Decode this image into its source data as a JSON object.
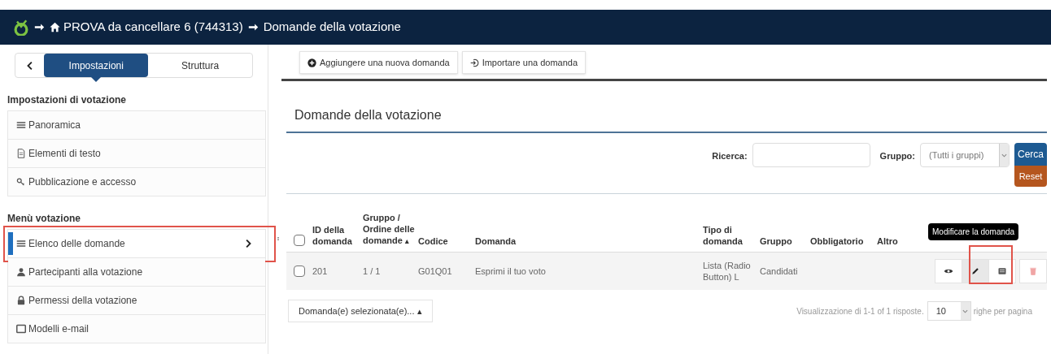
{
  "breadcrumb": {
    "survey": "PROVA da cancellare 6 (744313)",
    "page": "Domande della votazione"
  },
  "sidebar": {
    "tabs": [
      {
        "label": "Impostazioni",
        "selected": true
      },
      {
        "label": "Struttura",
        "selected": false
      }
    ],
    "sections": [
      {
        "title": "Impostazioni di votazione",
        "items": [
          {
            "label": "Panoramica",
            "selected": false,
            "highlighted": false
          },
          {
            "label": "Elementi di testo",
            "selected": false,
            "highlighted": false
          },
          {
            "label": "Pubblicazione e accesso",
            "selected": false,
            "highlighted": false
          }
        ]
      },
      {
        "title": "Menù votazione",
        "items": [
          {
            "label": "Elenco delle domande",
            "selected": true,
            "highlighted": true
          },
          {
            "label": "Partecipanti alla votazione",
            "selected": false,
            "highlighted": false
          },
          {
            "label": "Permessi della votazione",
            "selected": false,
            "highlighted": false
          },
          {
            "label": "Modelli e-mail",
            "selected": false,
            "highlighted": false
          }
        ]
      }
    ]
  },
  "toolbar": [
    {
      "label": "Aggiungere una nuova domanda"
    },
    {
      "label": "Importare una domanda"
    }
  ],
  "heading": "Domande della votazione",
  "filter": {
    "search_label": "Ricerca:",
    "group_label": "Gruppo:",
    "group_value": "(Tutti i gruppi)",
    "search_button": "Cerca",
    "reset_button": "Reset"
  },
  "table": {
    "columns": [
      "ID della domanda",
      "Gruppo / Ordine delle domande",
      "Codice",
      "Domanda",
      "Tipo di domanda",
      "Gruppo",
      "Obbligatorio",
      "Altro"
    ],
    "sort_mark": "▴",
    "all_checked": false,
    "rows": [
      {
        "checked": false,
        "cells": [
          "201",
          "1 / 1",
          "G01Q01",
          "Esprimi il tuo voto",
          "Lista (Radio Button) L",
          "Candidati",
          "",
          ""
        ],
        "highlighted": true,
        "actions": [
          {
            "kind": "preview",
            "selected": false
          },
          {
            "kind": "edit",
            "selected": true
          },
          {
            "kind": "summary",
            "selected": false
          },
          {
            "kind": "delete",
            "selected": false
          }
        ]
      }
    ]
  },
  "tooltip": "Modificare la domanda",
  "footer": {
    "mass_action": "Domanda(e) selezionata(e)... ▴",
    "summary": "Visualizzazione di 1-1 of 1 risposte.",
    "page_size": "10",
    "page_size_label": "righe per pagina"
  }
}
